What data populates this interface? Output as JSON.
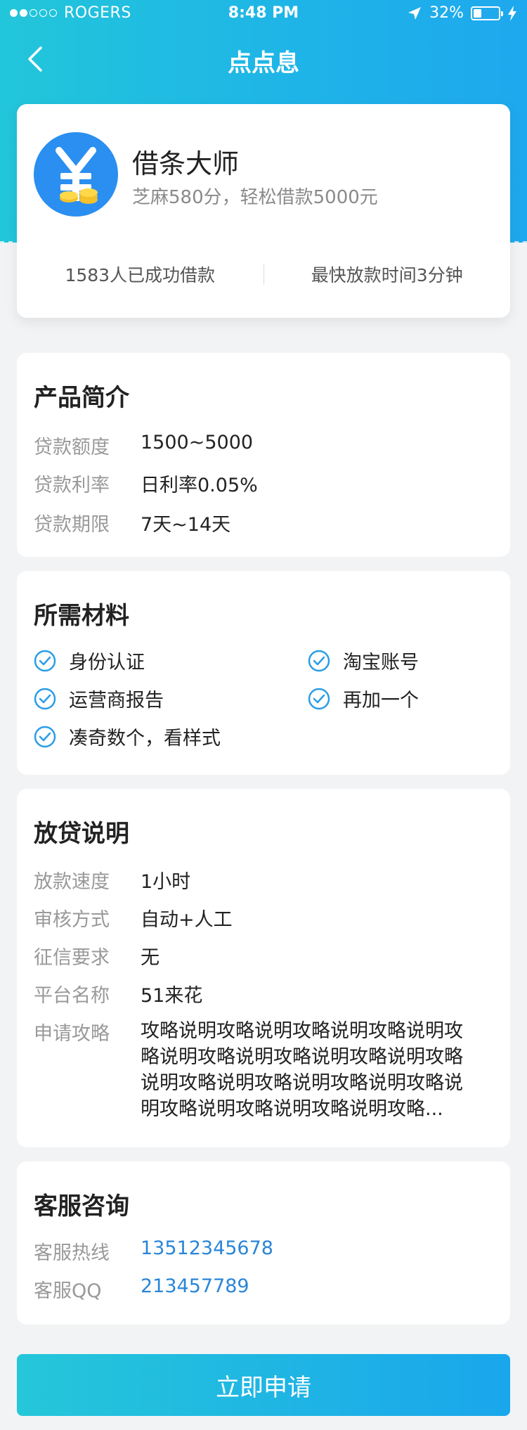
{
  "status_bar": {
    "carrier": "ROGERS",
    "time": "8:48 PM",
    "battery": "32%",
    "battery_level": 0.32,
    "signal_filled": 2,
    "signal_total": 5
  },
  "nav": {
    "title": "点点息",
    "back_icon": "chevron-left-icon"
  },
  "product": {
    "name": "借条大师",
    "subtitle": "芝麻580分，轻松借款5000元",
    "logo_icon": "yen-coin-icon",
    "stats": [
      "1583人已成功借款",
      "最快放款时间3分钟"
    ]
  },
  "intro": {
    "title": "产品简介",
    "rows": [
      {
        "label": "贷款额度",
        "value": "1500~5000"
      },
      {
        "label": "贷款利率",
        "value": "日利率0.05%"
      },
      {
        "label": "贷款期限",
        "value": "7天~14天"
      }
    ]
  },
  "materials": {
    "title": "所需材料",
    "items": [
      "身份认证",
      "淘宝账号",
      "运营商报告",
      "再加一个",
      "凑奇数个，看样式"
    ],
    "icon": "check-circle-icon"
  },
  "loan": {
    "title": "放贷说明",
    "rows": [
      {
        "label": "放款速度",
        "value": "1小时"
      },
      {
        "label": "审核方式",
        "value": "自动+人工"
      },
      {
        "label": "征信要求",
        "value": "无"
      },
      {
        "label": "平台名称",
        "value": "51来花"
      },
      {
        "label": "申请攻略",
        "value": "攻略说明攻略说明攻略说明攻略说明攻略说明攻略说明攻略说明攻略说明攻略说明攻略说明攻略说明攻略说明攻略说明攻略说明攻略说明攻略说明攻略..."
      }
    ]
  },
  "service": {
    "title": "客服咨询",
    "rows": [
      {
        "label": "客服热线",
        "value": "13512345678"
      },
      {
        "label": "客服QQ",
        "value": "213457789"
      }
    ]
  },
  "apply_button": "立即申请",
  "colors": {
    "accent": "#1ea8ee",
    "link": "#2a86d8",
    "check": "#2a9de8"
  }
}
